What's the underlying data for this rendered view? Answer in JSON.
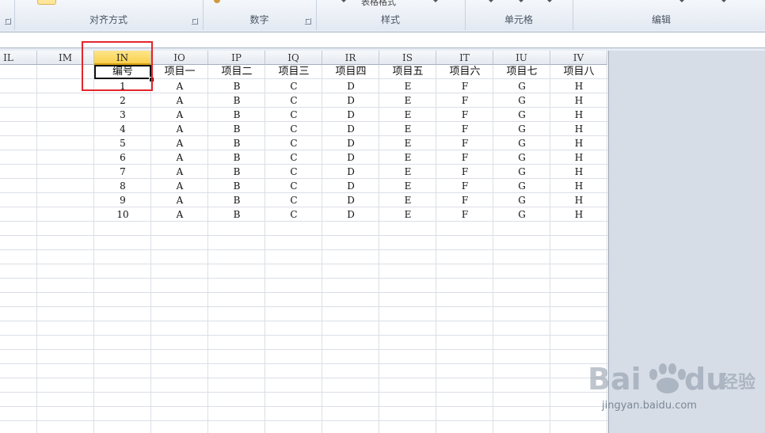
{
  "ribbon": {
    "groups": [
      {
        "label": "对齐方式"
      },
      {
        "label": "数字"
      },
      {
        "label": "样式",
        "stub": "表格格式"
      },
      {
        "label": "单元格"
      },
      {
        "label": "编辑"
      }
    ]
  },
  "sheet": {
    "columns": [
      "IL",
      "IM",
      "IN",
      "IO",
      "IP",
      "IQ",
      "IR",
      "IS",
      "IT",
      "IU",
      "IV"
    ],
    "active_column": "IN",
    "header_row": [
      "编号",
      "项目一",
      "项目二",
      "项目三",
      "项目四",
      "项目五",
      "项目六",
      "项目七",
      "项目八"
    ],
    "rows": [
      [
        "1",
        "A",
        "B",
        "C",
        "D",
        "E",
        "F",
        "G",
        "H"
      ],
      [
        "2",
        "A",
        "B",
        "C",
        "D",
        "E",
        "F",
        "G",
        "H"
      ],
      [
        "3",
        "A",
        "B",
        "C",
        "D",
        "E",
        "F",
        "G",
        "H"
      ],
      [
        "4",
        "A",
        "B",
        "C",
        "D",
        "E",
        "F",
        "G",
        "H"
      ],
      [
        "5",
        "A",
        "B",
        "C",
        "D",
        "E",
        "F",
        "G",
        "H"
      ],
      [
        "6",
        "A",
        "B",
        "C",
        "D",
        "E",
        "F",
        "G",
        "H"
      ],
      [
        "7",
        "A",
        "B",
        "C",
        "D",
        "E",
        "F",
        "G",
        "H"
      ],
      [
        "8",
        "A",
        "B",
        "C",
        "D",
        "E",
        "F",
        "G",
        "H"
      ],
      [
        "9",
        "A",
        "B",
        "C",
        "D",
        "E",
        "F",
        "G",
        "H"
      ],
      [
        "10",
        "A",
        "B",
        "C",
        "D",
        "E",
        "F",
        "G",
        "H"
      ]
    ]
  },
  "watermark": {
    "brand": "Bai百du经验",
    "url": "jingyan.baidu.com"
  },
  "colors": {
    "active_header": "#f9d04e",
    "highlight": "#e3262c"
  }
}
